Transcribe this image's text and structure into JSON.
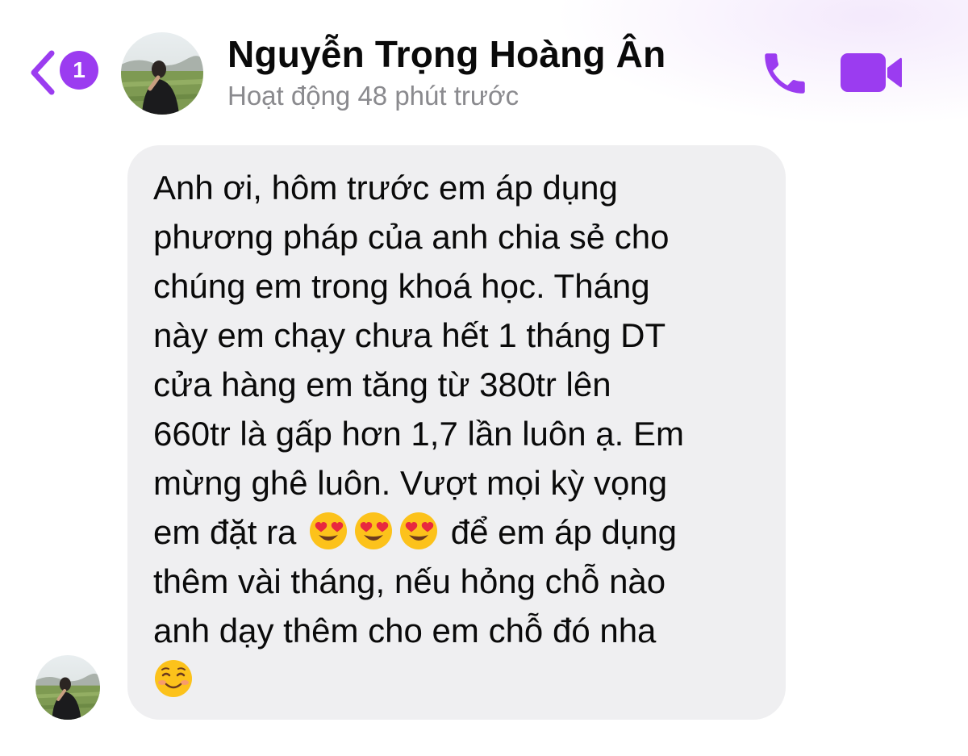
{
  "header": {
    "back_badge_count": "1",
    "contact_name": "Nguyễn Trọng Hoàng Ân",
    "status": "Hoạt động 48 phút trước"
  },
  "icons": {
    "back": "chevron-left-icon",
    "call": "phone-icon",
    "video": "video-camera-icon",
    "emoji_heart_eyes": "smiling-face-with-heart-eyes",
    "emoji_smiling": "smiling-face"
  },
  "colors": {
    "accent": "#9b3cf0",
    "bubble": "#efeff1",
    "status_text": "#8a8a8e"
  },
  "message": {
    "lines": [
      "Anh ơi, hôm trước em áp dụng",
      "phương pháp của anh chia sẻ cho",
      "chúng em trong khoá học. Tháng",
      "này em chạy chưa hết 1 tháng DT",
      "cửa hàng em tăng từ 380tr lên",
      "660tr là gấp hơn 1,7 lần luôn ạ. Em",
      "mừng ghê luôn. Vượt mọi kỳ vọng"
    ],
    "line8_before_emoji": "em đặt ra",
    "line8_after_emoji": "để em áp dụng",
    "line9": "thêm vài tháng, nếu hỏng chỗ nào",
    "line10": "anh dạy thêm cho em chỗ đó nha"
  }
}
